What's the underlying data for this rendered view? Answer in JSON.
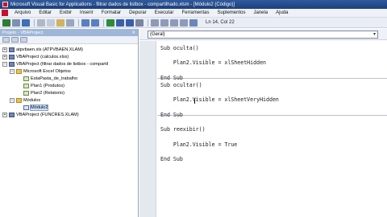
{
  "window": {
    "title": "Microsoft Visual Basic for Applications - filtrar dados de listbox - compartilhado.xlsm - [Módulo2 (Código)]"
  },
  "menu": [
    "Arquivo",
    "Editar",
    "Exibir",
    "Inserir",
    "Formatar",
    "Depurar",
    "Executar",
    "Ferramentas",
    "Suplementos",
    "Janela",
    "Ajuda"
  ],
  "toolbar": {
    "position": "Ln 14, Col 22"
  },
  "project_panel": {
    "title": "Projeto - VBAProject",
    "close": "✕",
    "tree": [
      {
        "label": "atpvbaen.xls (ATPVBAEN.XLAM)",
        "kind": "proj",
        "level": 0,
        "expander": "+"
      },
      {
        "label": "VBAProject (calculos.xlsx)",
        "kind": "proj",
        "level": 0,
        "expander": "+"
      },
      {
        "label": "VBAProject (filtrar dados de listbox - compartil",
        "kind": "proj",
        "level": 0,
        "expander": "−"
      },
      {
        "label": "Microsoft Excel Objetos",
        "kind": "folder",
        "level": 1,
        "expander": "−"
      },
      {
        "label": "EstaPasta_de_trabalho",
        "kind": "sheet",
        "level": 2,
        "expander": ""
      },
      {
        "label": "Plan1 (Produtos)",
        "kind": "sheet",
        "level": 2,
        "expander": ""
      },
      {
        "label": "Plan2 (Relatorio)",
        "kind": "sheet",
        "level": 2,
        "expander": ""
      },
      {
        "label": "Módulos",
        "kind": "folder",
        "level": 1,
        "expander": "−"
      },
      {
        "label": "Módulo2",
        "kind": "mod",
        "level": 2,
        "expander": "",
        "selected": true
      },
      {
        "label": "VBAProject (FUNCRES.XLAM)",
        "kind": "proj",
        "level": 0,
        "expander": "+"
      }
    ]
  },
  "code_window": {
    "object_combo": "(Geral)",
    "lines": [
      "Sub oculta()",
      "",
      "    Plan2.Visible = xlSheetHidden",
      "",
      "End Sub",
      "Sub ocultar()",
      "",
      "    Plan2.Visible = xlSheetVeryHidden",
      "",
      "End Sub",
      "",
      "Sub reexibir()",
      "",
      "    Plan2.Visible = True",
      "",
      "End Sub"
    ]
  },
  "colors": {
    "title_bg": "#1c3f7a",
    "panel_title_bg": "#9eb6d8",
    "code_bg": "#ffffff",
    "selection": "#cfe0f8"
  }
}
